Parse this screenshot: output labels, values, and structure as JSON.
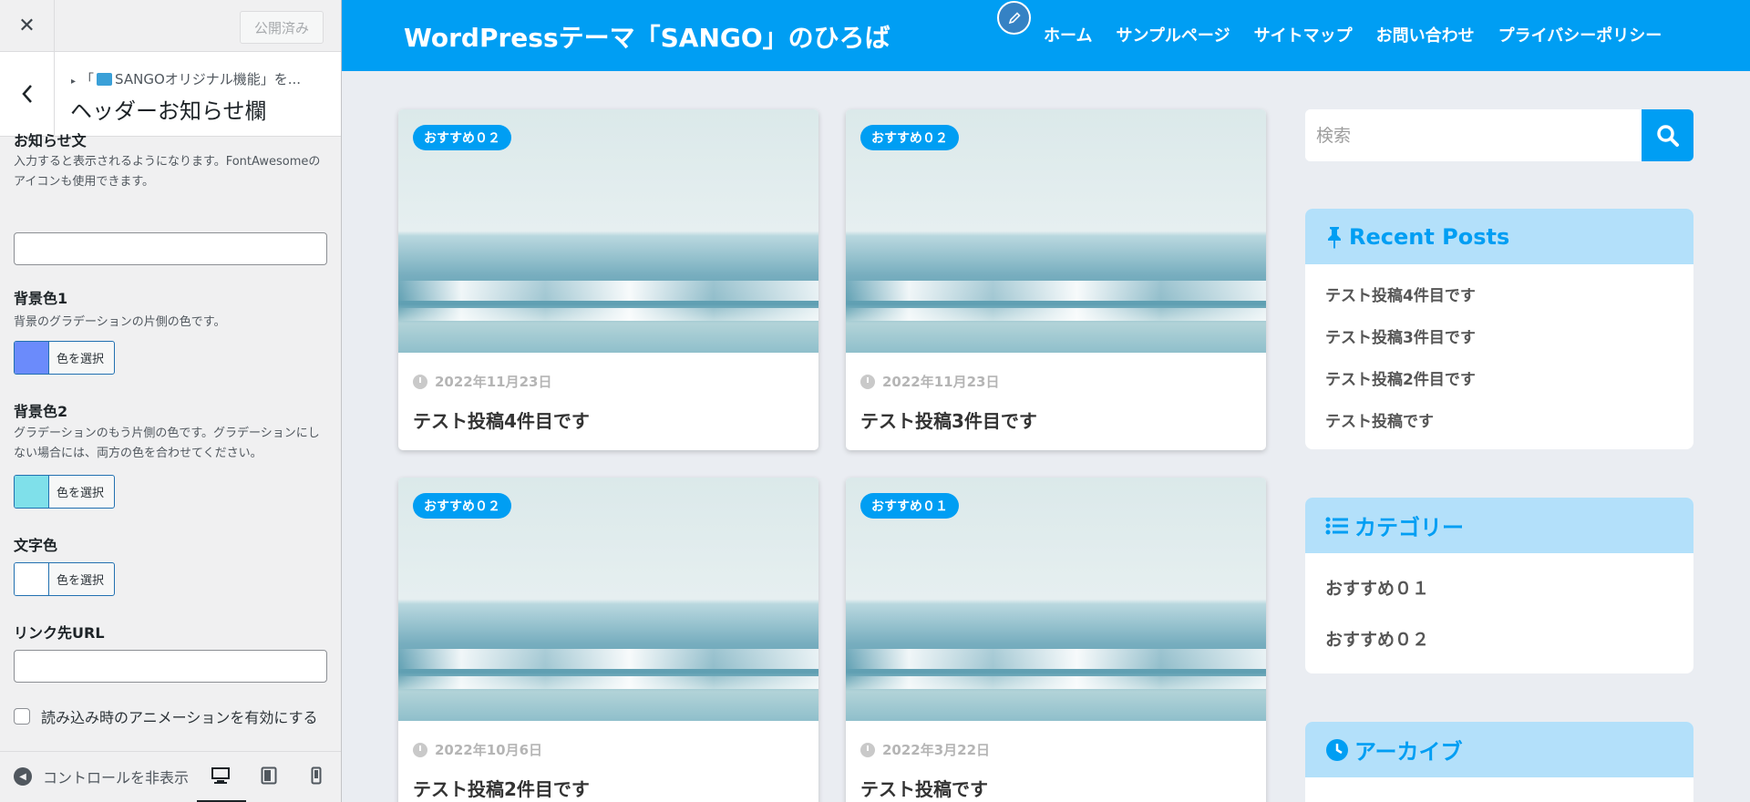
{
  "panel": {
    "publish_label": "公開済み",
    "breadcrumb": "「SANGOオリジナル機能」を...",
    "section_title": "ヘッダーお知らせ欄",
    "controls": {
      "notice_title": "お知らせ文",
      "notice_desc": "入力すると表示されるようになります。FontAwesomeのアイコンも使用できます。",
      "notice_value": "",
      "bg1_title": "背景色1",
      "bg1_desc": "背景のグラデーションの片側の色です。",
      "bg1_color": "#6b8bfb",
      "bg2_title": "背景色2",
      "bg2_desc": "グラデーションのもう片側の色です。グラデーションにしない場合には、両方の色を合わせてください。",
      "bg2_color": "#7fe0ea",
      "text_color_title": "文字色",
      "text_color": "#ffffff",
      "select_color_label": "色を選択",
      "link_title": "リンク先URL",
      "link_value": "",
      "animation_label": "読み込み時のアニメーションを有効にする"
    },
    "footer": {
      "collapse_label": "コントロールを非表示"
    }
  },
  "site": {
    "title": "WordPressテーマ「SANGO」のひろば",
    "nav": [
      "ホーム",
      "サンプルページ",
      "サイトマップ",
      "お問い合わせ",
      "プライバシーポリシー"
    ],
    "posts": [
      {
        "badge": "おすすめ０２",
        "date": "2022年11月23日",
        "title": "テスト投稿4件目です"
      },
      {
        "badge": "おすすめ０２",
        "date": "2022年11月23日",
        "title": "テスト投稿3件目です"
      },
      {
        "badge": "おすすめ０２",
        "date": "2022年10月6日",
        "title": "テスト投稿2件目です"
      },
      {
        "badge": "おすすめ０１",
        "date": "2022年3月22日",
        "title": "テスト投稿です"
      }
    ],
    "search_placeholder": "検索",
    "recent_posts": {
      "title": "Recent Posts",
      "items": [
        "テスト投稿4件目です",
        "テスト投稿3件目です",
        "テスト投稿2件目です",
        "テスト投稿です"
      ]
    },
    "categories": {
      "title": "カテゴリー",
      "items": [
        "おすすめ０１",
        "おすすめ０２"
      ]
    },
    "archives": {
      "title": "アーカイブ"
    },
    "colors": {
      "header": "#009ef3",
      "accent": "#009ef3",
      "widget_head": "#b3e0fa"
    }
  }
}
